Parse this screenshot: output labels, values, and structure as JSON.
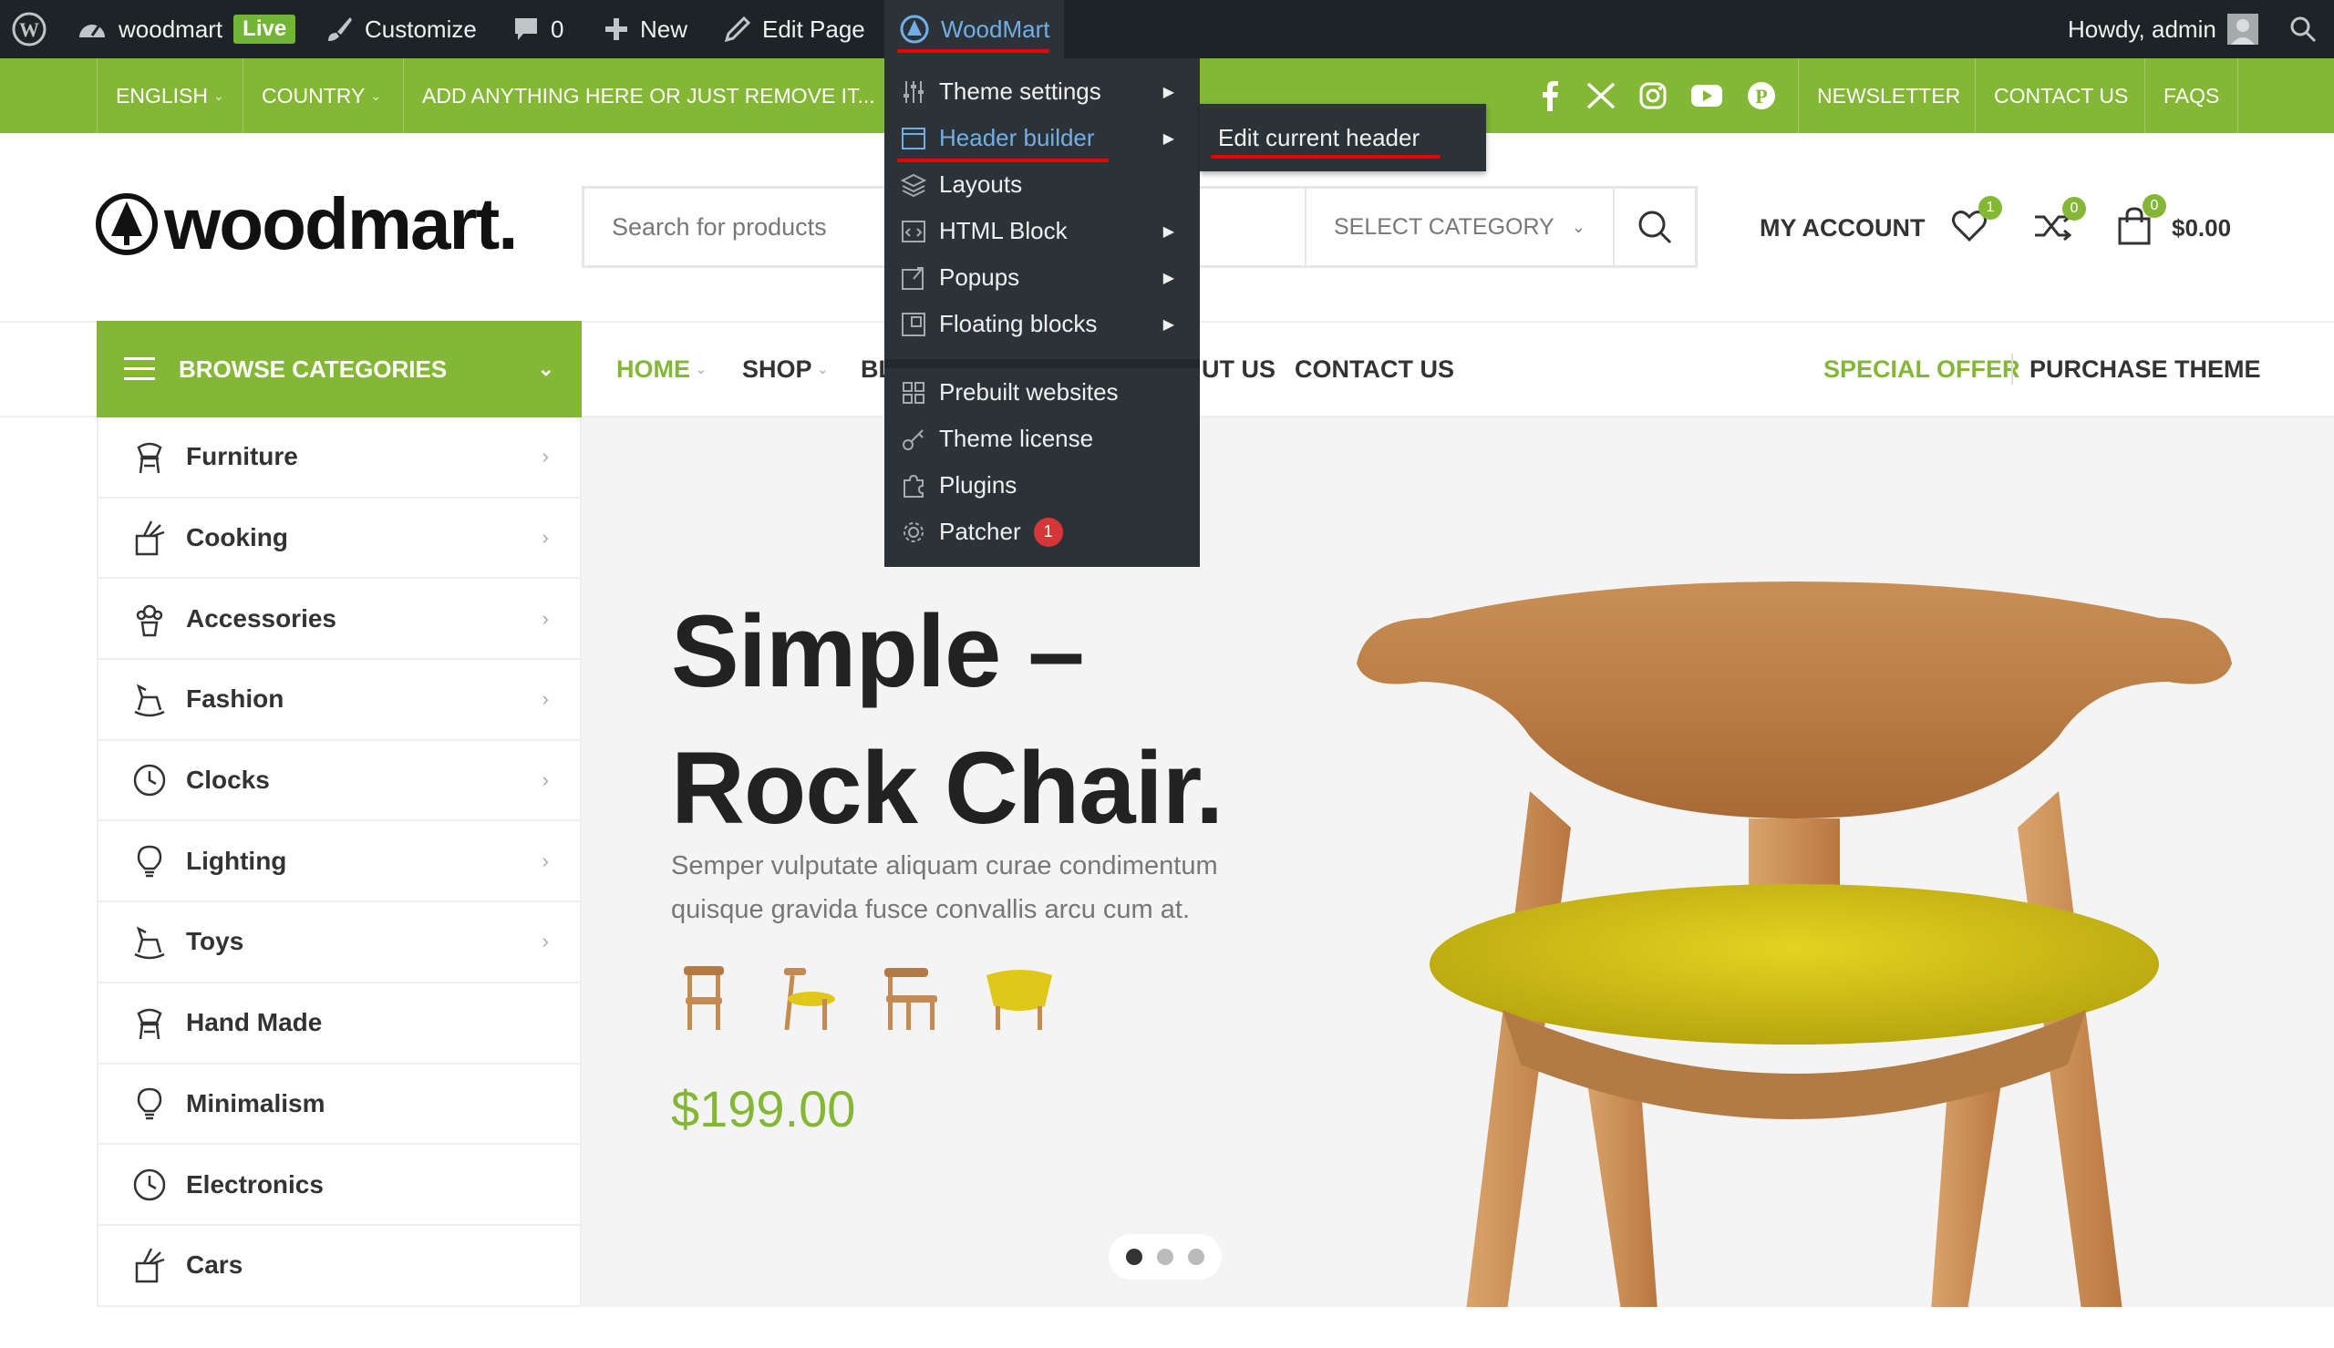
{
  "adminbar": {
    "site_name": "woodmart",
    "live": "Live",
    "customize": "Customize",
    "comments": "0",
    "new": "New",
    "edit_page": "Edit Page",
    "woodmart": "WoodMart",
    "howdy": "Howdy, admin"
  },
  "woodmart_menu": {
    "items": [
      "Theme settings",
      "Header builder",
      "Layouts",
      "HTML Block",
      "Popups",
      "Floating blocks",
      "Prebuilt websites",
      "Theme license",
      "Plugins",
      "Patcher"
    ],
    "patcher_badge": "1",
    "submenu_item": "Edit current header"
  },
  "topbar": {
    "language": "ENGLISH",
    "country": "COUNTRY",
    "promo": "ADD ANYTHING HERE OR JUST REMOVE IT...",
    "newsletter": "NEWSLETTER",
    "contact": "CONTACT US",
    "faqs": "FAQS"
  },
  "header": {
    "logo": "woodmart.",
    "search_placeholder": "Search for products",
    "select_category": "SELECT CATEGORY",
    "my_account": "MY ACCOUNT",
    "wishlist_count": "1",
    "compare_count": "0",
    "cart_count": "0",
    "cart_total": "$0.00"
  },
  "nav": {
    "browse": "BROWSE CATEGORIES",
    "home": "HOME",
    "shop": "SHOP",
    "blog_partial": "BL",
    "about_partial": "UT US",
    "contact": "CONTACT US",
    "special": "SPECIAL OFFER",
    "purchase": "PURCHASE THEME"
  },
  "categories": [
    "Furniture",
    "Cooking",
    "Accessories",
    "Fashion",
    "Clocks",
    "Lighting",
    "Toys",
    "Hand Made",
    "Minimalism",
    "Electronics",
    "Cars"
  ],
  "hero": {
    "title_line1": "Simple –",
    "title_line2": "Rock Chair.",
    "subtitle": "Semper vulputate aliquam curae condimentum quisque gravida fusce convallis arcu cum at.",
    "price": "$199.00"
  },
  "colors": {
    "brand_green": "#83b735",
    "admin_bar": "#1d2327",
    "menu_bg": "#2c3338",
    "highlight": "#e00000"
  }
}
